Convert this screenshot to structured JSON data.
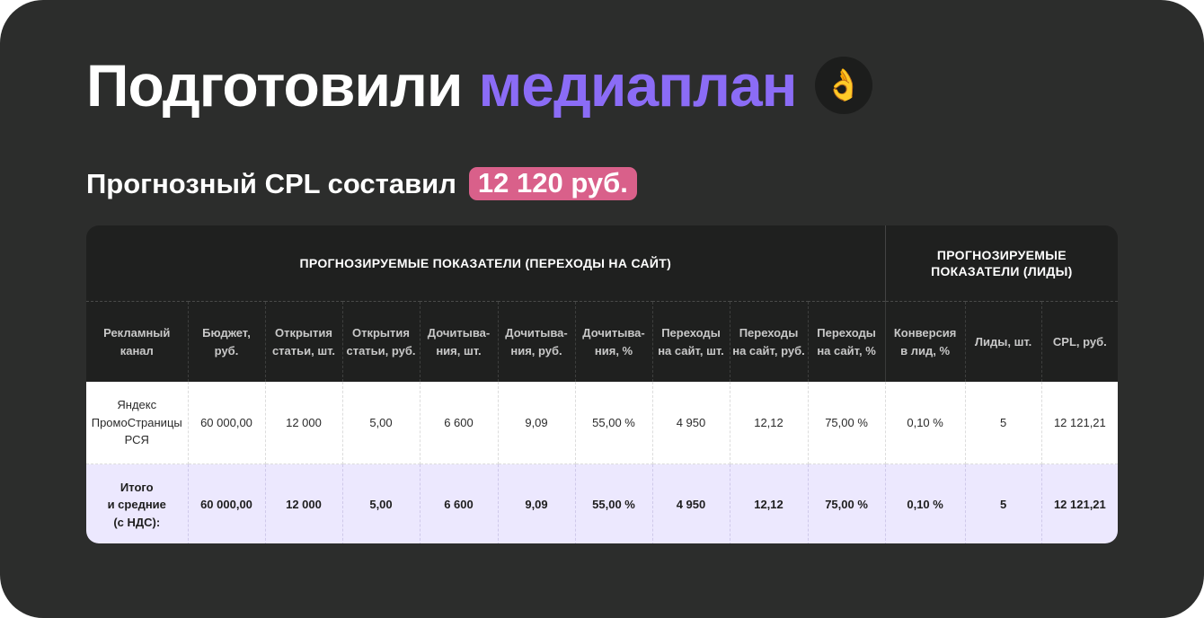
{
  "heading": {
    "title_main": "Подготовили",
    "title_accent": "медиаплан",
    "emoji": "👌",
    "subtitle": "Прогнозный CPL составил",
    "cpl_value": "12 120 руб."
  },
  "colors": {
    "background": "#2c2d2c",
    "accent_purple": "#8b6cf6",
    "badge_pink": "#d9608a",
    "table_header": "#1f201f",
    "total_row": "#ece8fe"
  },
  "table": {
    "groups": [
      {
        "label": "ПРОГНОЗИРУЕМЫЕ ПОКАЗАТЕЛИ (ПЕРЕХОДЫ НА САЙТ)"
      },
      {
        "label_line1": "ПРОГНОЗИРУЕМЫЕ",
        "label_line2": "ПОКАЗАТЕЛИ (ЛИДЫ)"
      }
    ],
    "columns": [
      {
        "l1": "Рекламный",
        "l2": "канал"
      },
      {
        "l1": "Бюджет,",
        "l2": "руб."
      },
      {
        "l1": "Открытия",
        "l2": "статьи, шт."
      },
      {
        "l1": "Открытия",
        "l2": "статьи, руб."
      },
      {
        "l1": "Дочитыва-",
        "l2": "ния, шт."
      },
      {
        "l1": "Дочитыва-",
        "l2": "ния, руб."
      },
      {
        "l1": "Дочитыва-",
        "l2": "ния, %"
      },
      {
        "l1": "Переходы",
        "l2": "на сайт, шт."
      },
      {
        "l1": "Переходы",
        "l2": "на сайт, руб."
      },
      {
        "l1": "Переходы",
        "l2": "на сайт, %"
      },
      {
        "l1": "Конверсия",
        "l2": "в лид, %"
      },
      {
        "l1": "Лиды, шт.",
        "l2": ""
      },
      {
        "l1": "CPL, руб.",
        "l2": ""
      }
    ],
    "row": {
      "channel": [
        "Яндекс",
        "ПромоСтраницы",
        "РСЯ"
      ],
      "values": [
        "60 000,00",
        "12 000",
        "5,00",
        "6 600",
        "9,09",
        "55,00 %",
        "4 950",
        "12,12",
        "75,00 %",
        "0,10 %",
        "5",
        "12 121,21"
      ]
    },
    "total": {
      "label": [
        "Итого",
        "и средние",
        "(с НДС):"
      ],
      "values": [
        "60 000,00",
        "12 000",
        "5,00",
        "6 600",
        "9,09",
        "55,00 %",
        "4 950",
        "12,12",
        "75,00 %",
        "0,10 %",
        "5",
        "12 121,21"
      ]
    }
  }
}
